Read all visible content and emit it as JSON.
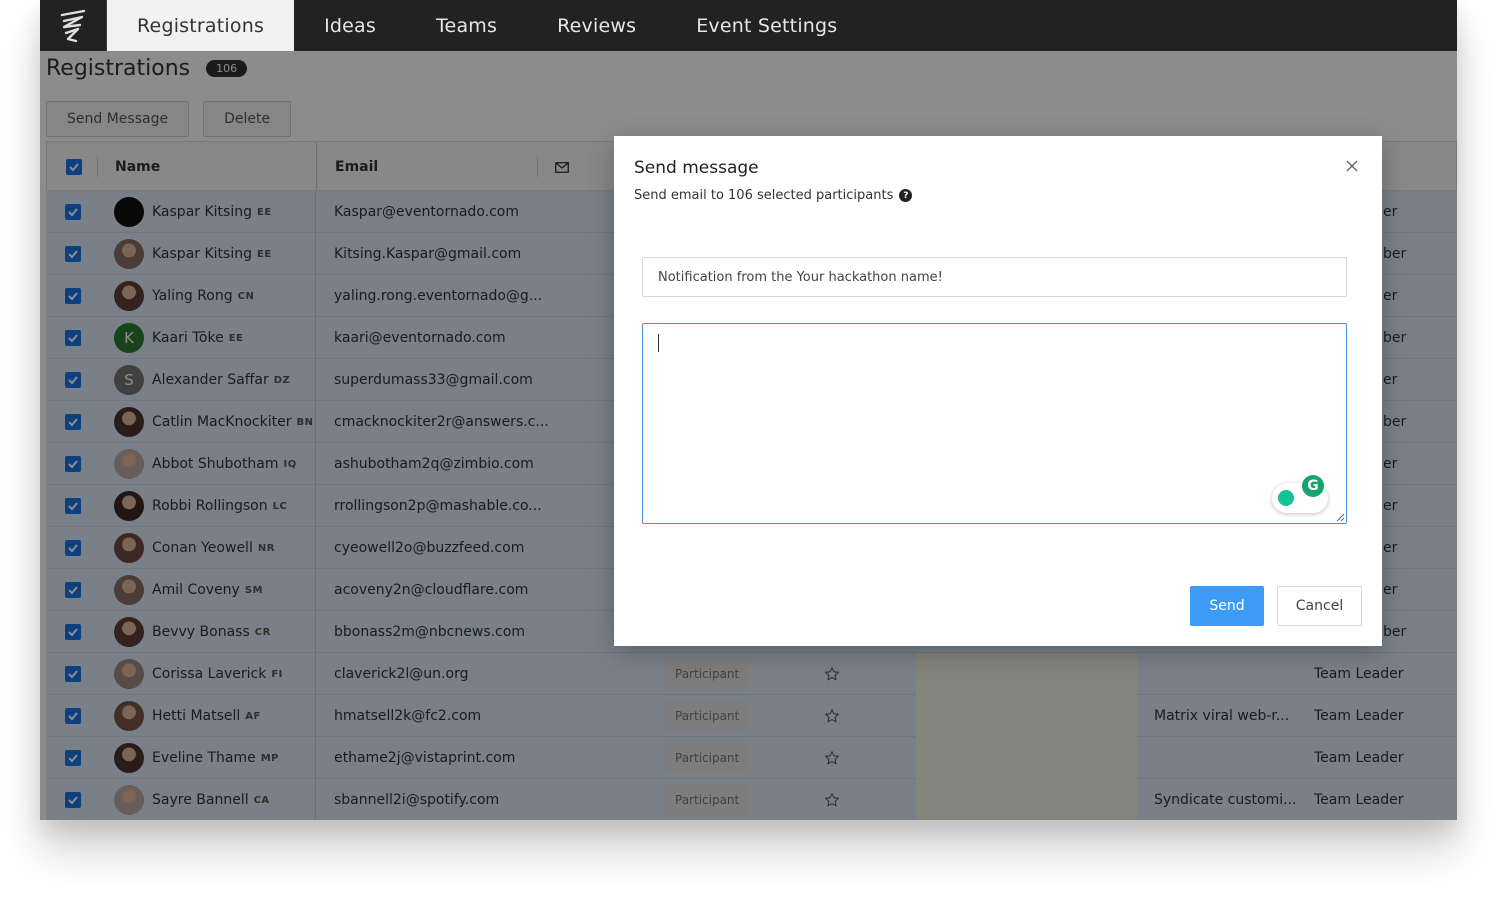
{
  "nav": {
    "tabs": [
      {
        "label": "Registrations",
        "active": true
      },
      {
        "label": "Ideas",
        "active": false
      },
      {
        "label": "Teams",
        "active": false
      },
      {
        "label": "Reviews",
        "active": false
      },
      {
        "label": "Event Settings",
        "active": false
      }
    ]
  },
  "page": {
    "title": "Registrations",
    "count": "106"
  },
  "toolbar": {
    "send_message_label": "Send Message",
    "delete_label": "Delete"
  },
  "table": {
    "headers": {
      "name": "Name",
      "email": "Email"
    },
    "rows": [
      {
        "name": "Kaspar Kitsing",
        "country": "EE",
        "email": "Kaspar@eventornado.com",
        "avatar": "dark",
        "right_text": "er"
      },
      {
        "name": "Kaspar Kitsing",
        "country": "EE",
        "email": "Kitsing.Kaspar@gmail.com",
        "avatar": "photo",
        "right_text": "ber"
      },
      {
        "name": "Yaling Rong",
        "country": "CN",
        "email": "yaling.rong.eventornado@g...",
        "avatar": "photo",
        "right_text": "er"
      },
      {
        "name": "Kaari Tõke",
        "country": "EE",
        "email": "kaari@eventornado.com",
        "avatar": "letter",
        "letter": "K",
        "avatar_color": "#2e7d32",
        "right_text": "ber"
      },
      {
        "name": "Alexander Saffar",
        "country": "DZ",
        "email": "superdumass33@gmail.com",
        "avatar": "letter",
        "letter": "S",
        "avatar_color": "#757575",
        "right_text": "er"
      },
      {
        "name": "Catlin MacKnockiter",
        "country": "BN",
        "email": "cmacknockiter2r@answers.c...",
        "avatar": "photo",
        "right_text": "ber"
      },
      {
        "name": "Abbot Shubotham",
        "country": "IQ",
        "email": "ashubotham2q@zimbio.com",
        "avatar": "photo",
        "right_text": "er"
      },
      {
        "name": "Robbi Rollingson",
        "country": "LC",
        "email": "rrollingson2p@mashable.co...",
        "avatar": "photo",
        "right_text": "er"
      },
      {
        "name": "Conan Yeowell",
        "country": "NR",
        "email": "cyeowell2o@buzzfeed.com",
        "avatar": "photo",
        "right_text": "er"
      },
      {
        "name": "Amil Coveny",
        "country": "SM",
        "email": "acoveny2n@cloudflare.com",
        "avatar": "photo",
        "right_text": "er"
      },
      {
        "name": "Bevvy Bonass",
        "country": "CR",
        "email": "bbonass2m@nbcnews.com",
        "avatar": "photo",
        "right_text": "ber"
      },
      {
        "name": "Corissa Laverick",
        "country": "FI",
        "email": "claverick2l@un.org",
        "avatar": "photo",
        "tag": "Participant",
        "idea": "",
        "role": "Team Leader"
      },
      {
        "name": "Hetti Matsell",
        "country": "AF",
        "email": "hmatsell2k@fc2.com",
        "avatar": "photo",
        "tag": "Participant",
        "idea": "Matrix viral web-r...",
        "role": "Team Leader"
      },
      {
        "name": "Eveline Thame",
        "country": "MP",
        "email": "ethame2j@vistaprint.com",
        "avatar": "photo",
        "tag": "Participant",
        "idea": "",
        "role": "Team Leader"
      },
      {
        "name": "Sayre Bannell",
        "country": "CA",
        "email": "sbannell2i@spotify.com",
        "avatar": "photo",
        "tag": "Participant",
        "idea": "Syndicate customi...",
        "role": "Team Leader"
      }
    ]
  },
  "modal": {
    "title": "Send message",
    "subtitle": "Send email to 106 selected participants",
    "subject_value": "Notification from the Your hackathon name!",
    "body_value": "",
    "send_label": "Send",
    "cancel_label": "Cancel"
  },
  "colors": {
    "nav_bg": "#222222",
    "row_selected": "#dce9f7",
    "checkbox": "#1a73e8",
    "send_button": "#3d9bf8",
    "textarea_focus": "#4a90e2"
  }
}
